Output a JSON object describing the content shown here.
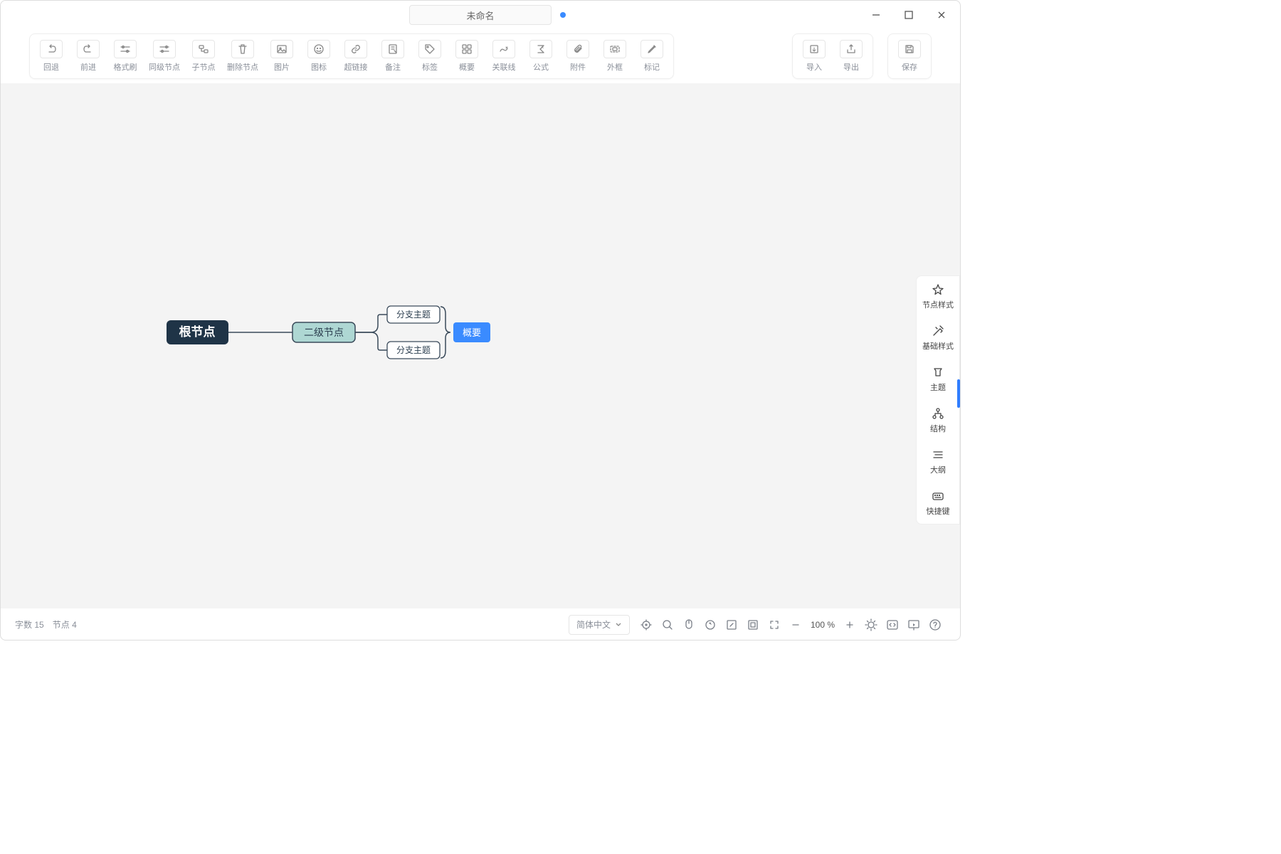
{
  "title_input": "未命名",
  "window_controls": {
    "minimize": "minimize",
    "maximize": "maximize",
    "close": "close"
  },
  "toolbar": {
    "groups": {
      "main": [
        {
          "name": "undo",
          "label": "回退"
        },
        {
          "name": "redo",
          "label": "前进"
        },
        {
          "name": "format-painter",
          "label": "格式刷"
        },
        {
          "name": "sibling-node",
          "label": "同级节点"
        },
        {
          "name": "child-node",
          "label": "子节点"
        },
        {
          "name": "delete-node",
          "label": "删除节点"
        },
        {
          "name": "image",
          "label": "图片"
        },
        {
          "name": "icon",
          "label": "图标"
        },
        {
          "name": "hyperlink",
          "label": "超链接"
        },
        {
          "name": "note",
          "label": "备注"
        },
        {
          "name": "tag",
          "label": "标签"
        },
        {
          "name": "summary",
          "label": "概要"
        },
        {
          "name": "relation",
          "label": "关联线"
        },
        {
          "name": "formula",
          "label": "公式"
        },
        {
          "name": "attachment",
          "label": "附件"
        },
        {
          "name": "boundary",
          "label": "外框"
        },
        {
          "name": "marker",
          "label": "标记"
        }
      ],
      "io": [
        {
          "name": "import",
          "label": "导入"
        },
        {
          "name": "export",
          "label": "导出"
        }
      ],
      "save": [
        {
          "name": "save",
          "label": "保存"
        }
      ]
    }
  },
  "mindmap": {
    "root": "根节点",
    "level2": "二级节点",
    "branch1": "分支主题",
    "branch2": "分支主题",
    "summary": "概要"
  },
  "side_panel": [
    {
      "name": "node-style",
      "label": "节点样式"
    },
    {
      "name": "base-style",
      "label": "基础样式"
    },
    {
      "name": "theme",
      "label": "主题"
    },
    {
      "name": "structure",
      "label": "结构"
    },
    {
      "name": "outline",
      "label": "大纲"
    },
    {
      "name": "shortcuts",
      "label": "快捷键"
    }
  ],
  "side_active_index": 2,
  "footer": {
    "word_count_label": "字数",
    "word_count": 15,
    "node_count_label": "节点",
    "node_count": 4,
    "language": "简体中文",
    "zoom": "100 %"
  }
}
